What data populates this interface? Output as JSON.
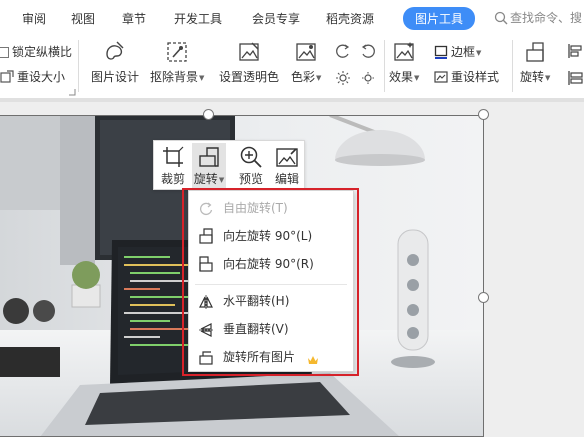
{
  "menu_tabs": [
    {
      "label": "审阅"
    },
    {
      "label": "视图"
    },
    {
      "label": "章节"
    },
    {
      "label": "开发工具"
    },
    {
      "label": "会员专享"
    },
    {
      "label": "稻壳资源"
    },
    {
      "label": "图片工具",
      "active": true
    }
  ],
  "search": {
    "label": "查找命令、搜"
  },
  "ribbon": {
    "lock_ratio_label": "锁定纵横比",
    "reset_size_label": "重设大小",
    "picture_design_label": "图片设计",
    "remove_bg_label": "抠除背景",
    "set_transparent_label": "设置透明色",
    "color_label": "色彩",
    "effects_label": "效果",
    "border_label": "边框",
    "reset_style_label": "重设样式",
    "rotate_label": "旋转"
  },
  "float_toolbar": {
    "crop_label": "裁剪",
    "rotate_label": "旋转",
    "preview_label": "预览",
    "edit_label": "编辑"
  },
  "rotate_menu": {
    "items": [
      {
        "label": "自由旋转(T)",
        "enabled": false
      },
      {
        "label": "向左旋转 90°(L)",
        "enabled": true
      },
      {
        "label": "向右旋转 90°(R)",
        "enabled": true
      },
      {
        "label": "水平翻转(H)",
        "enabled": true
      },
      {
        "label": "垂直翻转(V)",
        "enabled": true
      },
      {
        "label": "旋转所有图片",
        "enabled": true,
        "badge": "crown-icon"
      }
    ]
  },
  "colors": {
    "accent": "#3e8df7",
    "highlight_border": "#d6222a",
    "crown": "#f5b82e"
  }
}
